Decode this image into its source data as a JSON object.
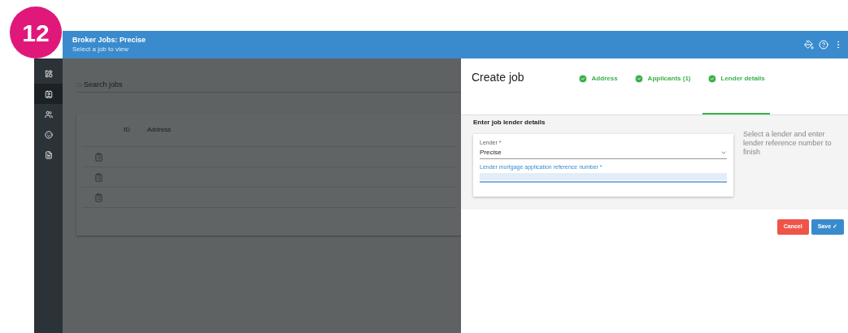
{
  "badge": "12",
  "header": {
    "title": "Broker Jobs: Precise",
    "subtitle": "Select a job to view"
  },
  "sidebar": {
    "items": [
      {
        "kind": "dashboard",
        "selected": false
      },
      {
        "kind": "contact",
        "selected": true
      },
      {
        "kind": "people",
        "selected": false
      },
      {
        "kind": "face",
        "selected": false
      },
      {
        "kind": "document",
        "selected": false
      }
    ]
  },
  "search": {
    "placeholder": "Search jobs"
  },
  "table": {
    "columns": [
      "ID",
      "Address"
    ],
    "rows": [
      {
        "kind": "clipboard"
      },
      {
        "kind": "clipboard"
      },
      {
        "kind": "clipboard"
      }
    ]
  },
  "dialog": {
    "title": "Create job",
    "steps": [
      {
        "label": "Address",
        "completed": true,
        "selected": false
      },
      {
        "label": "Applicants (1)",
        "completed": true,
        "selected": false
      },
      {
        "label": "Lender details",
        "completed": true,
        "selected": true
      }
    ],
    "section_title": "Enter job lender details",
    "lender": {
      "label": "Lender *",
      "value": "Precise"
    },
    "reference": {
      "label": "Lender mortgage application reference number *",
      "focused": true
    },
    "hint": "Select a lender and enter lender reference number to finish",
    "buttons": [
      {
        "kind": "cancel",
        "label": "Cancel"
      },
      {
        "kind": "save",
        "label": "Save ✓"
      }
    ]
  }
}
